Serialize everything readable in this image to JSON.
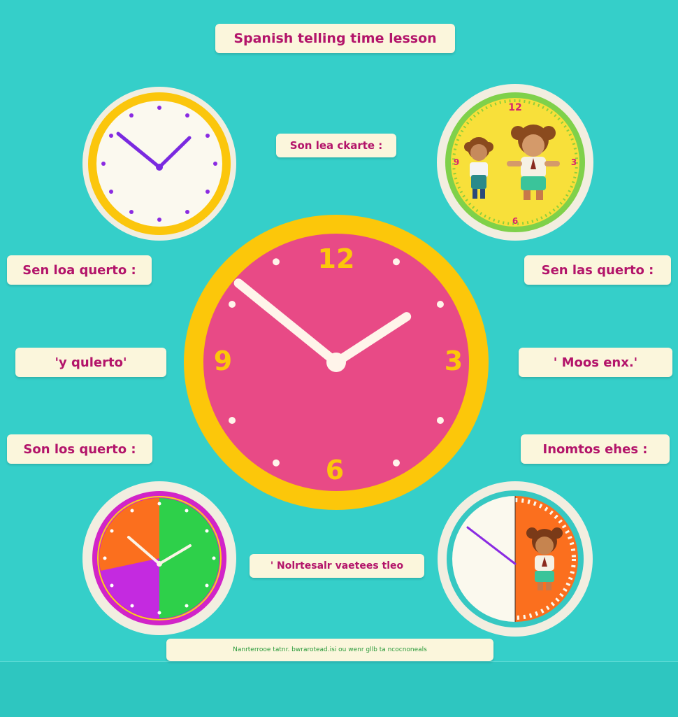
{
  "title": "Spanish telling time lesson",
  "labels": {
    "top_center": "Son lea ckarte :",
    "left_1": "Sen loa querto :",
    "right_1": "Sen las querto :",
    "left_2": "'y qulerto'",
    "right_2": "' Moos enx.'",
    "left_3": "Son los querto :",
    "right_3": "Inomtos ehes :",
    "bottom_center": "' Nolrtesalr vaetees tleo",
    "footer": "Nanrterrooe tatnr. bwrarotead.isi ou wenr  gllb ta ncocnoneals"
  },
  "main_clock": {
    "numerals": [
      "12",
      "3",
      "6",
      "9"
    ],
    "hour_value": 1.9,
    "minute_value": 51.5
  },
  "colors": {
    "background": "#35cfc9",
    "label_text": "#b3146a",
    "label_bg": "#fbf6dc",
    "main_face": "#e84a86",
    "main_rim": "#fcc70a",
    "numeral": "#fcc70a"
  },
  "icons": [
    "girl-character-icon",
    "boy-character-icon",
    "child-character-icon"
  ]
}
